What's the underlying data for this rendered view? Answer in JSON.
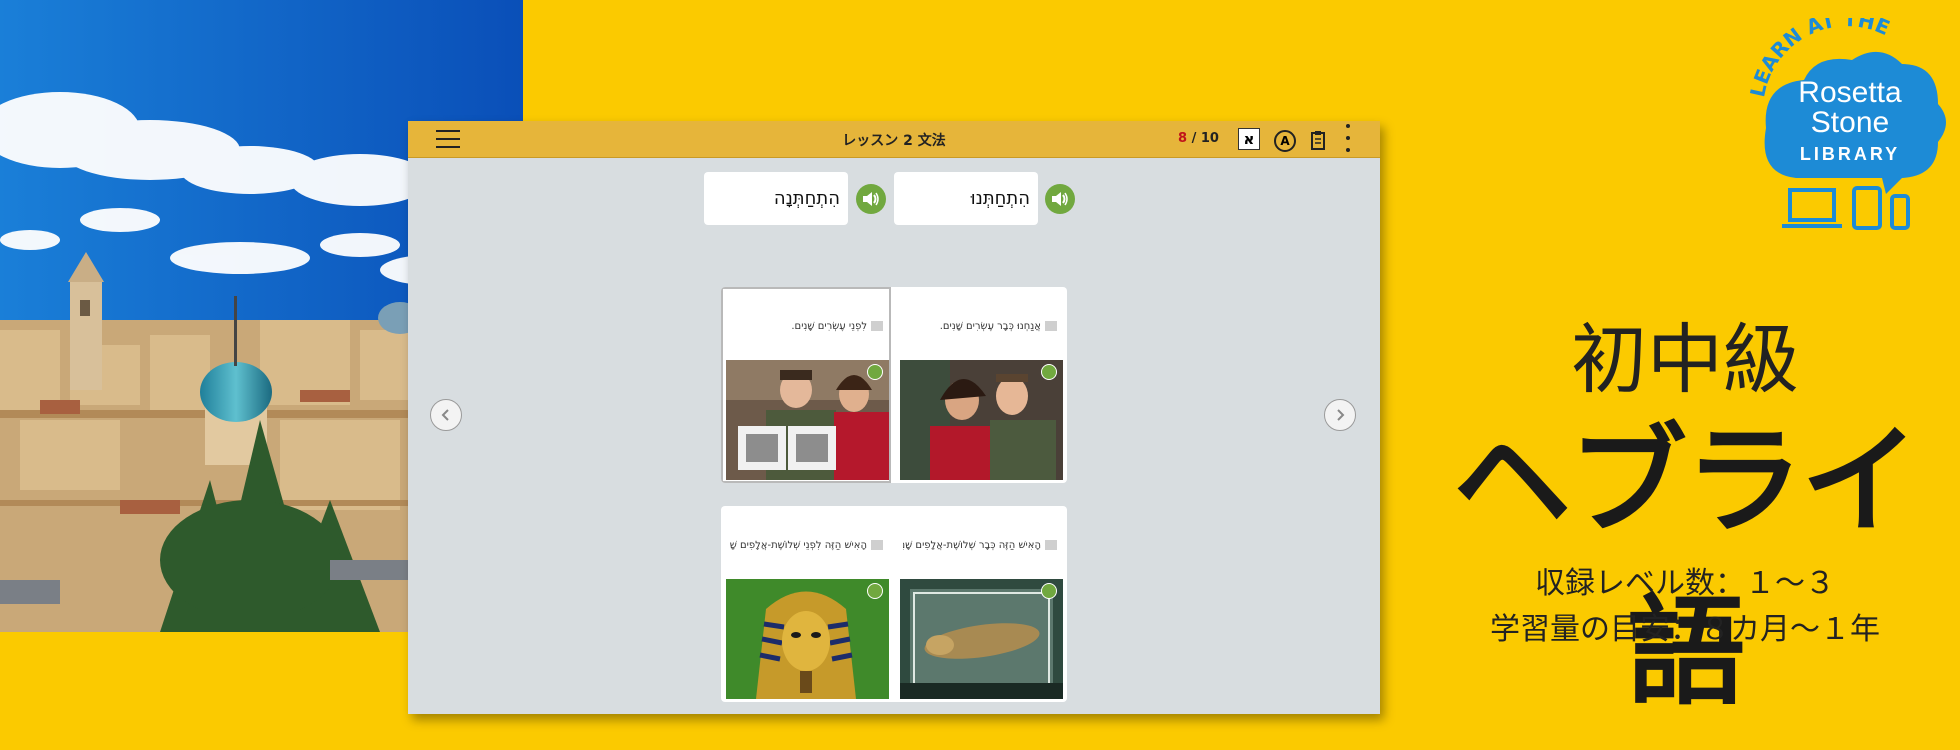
{
  "app": {
    "lesson_title": "レッスン 2 文法",
    "progress_current": "8",
    "progress_sep_total": " / 10",
    "alef_icon_glyph": "א",
    "a_icon_glyph": "A"
  },
  "word_choices": [
    {
      "text": "הִתְחַתְּנָה"
    },
    {
      "text": "הִתְחַתְּנוּ"
    }
  ],
  "image_cards": [
    {
      "caption": "לִפְנֵי עֶשְׂרִים שָׁנִים.",
      "image": "couple-holding-wedding-photos",
      "selected": true
    },
    {
      "caption": "אֲנַחְנוּ כְּבָר עֶשְׂרִים שָׁנִים.",
      "image": "couple-smiling-portrait",
      "selected": false
    },
    {
      "caption": "הָאִישׁ הַזֶּה לִפְנֵי שְׁלוֹשֶׁת-אֲלָפִים שָׁנִים.",
      "image": "golden-pharaoh-mask",
      "selected": false
    },
    {
      "caption": "הָאִישׁ הַזֶּה כְּבָר שְׁלוֹשֶׁת-אֲלָפִים שָׁנִים.",
      "image": "mummy-in-display-case",
      "selected": false
    }
  ],
  "branding": {
    "logo_arc_text": "LEARN AT THE",
    "logo_line1": "Rosetta",
    "logo_line2": "Stone",
    "logo_line3": "LIBRARY",
    "level": "初中級",
    "language": "ヘブライ語",
    "levels_info": "収録レベル数：１～３",
    "study_info": "学習量の目安：８カ月～１年"
  },
  "colors": {
    "background": "#fbca00",
    "topbar": "#e6b53a",
    "speaker_green": "#71a83f",
    "logo_blue": "#1d8bd6"
  }
}
